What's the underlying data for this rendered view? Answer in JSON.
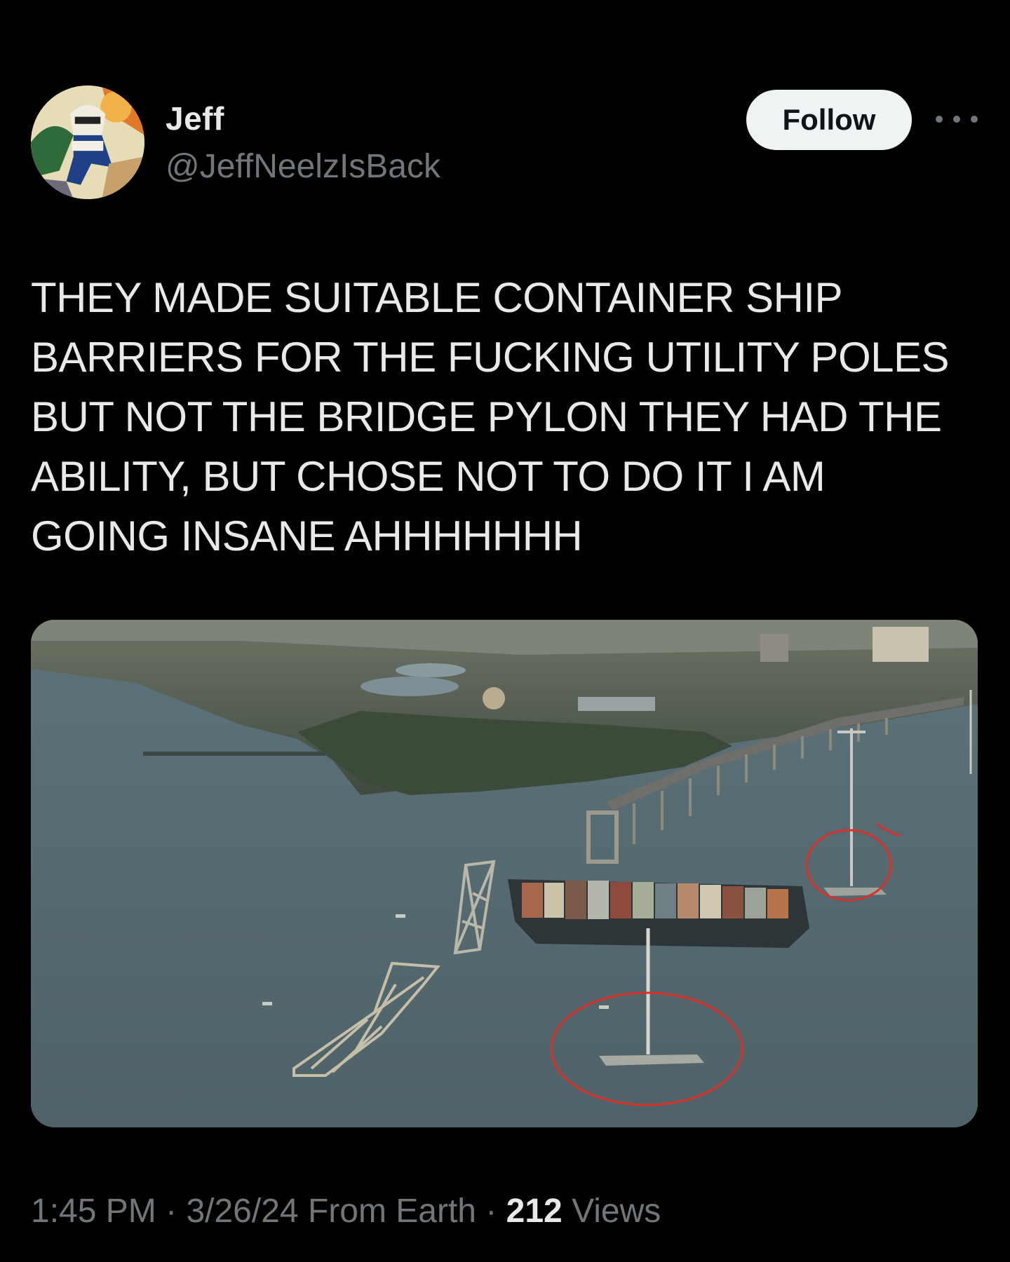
{
  "author": {
    "display_name": "Jeff",
    "handle": "@JeffNeelzIsBack",
    "avatar_icon": "cartoon-avatar-image"
  },
  "actions": {
    "follow_label": "Follow",
    "more_icon": "more-horizontal-icon"
  },
  "tweet": {
    "text": "THEY MADE SUITABLE CONTAINER SHIP\nBARRIERS FOR THE FUCKING UTILITY POLES\nBUT NOT THE BRIDGE PYLON THEY HAD THE\nABILITY, BUT CHOSE NOT TO DO IT I AM\nGOING INSANE AHHHHHHH"
  },
  "media": {
    "type": "photo",
    "subject": "aerial-bridge-collapse-container-ship-photo",
    "annotation_color": "#d9302a"
  },
  "meta": {
    "time": "1:45 PM",
    "separator": "·",
    "date": "3/26/24",
    "source": "From Earth",
    "views_count": "212",
    "views_label": "Views"
  },
  "colors": {
    "background": "#000000",
    "text_primary": "#e7e9ea",
    "text_secondary": "#71767b",
    "button_bg": "#eff3f4",
    "button_text": "#0f1419"
  }
}
